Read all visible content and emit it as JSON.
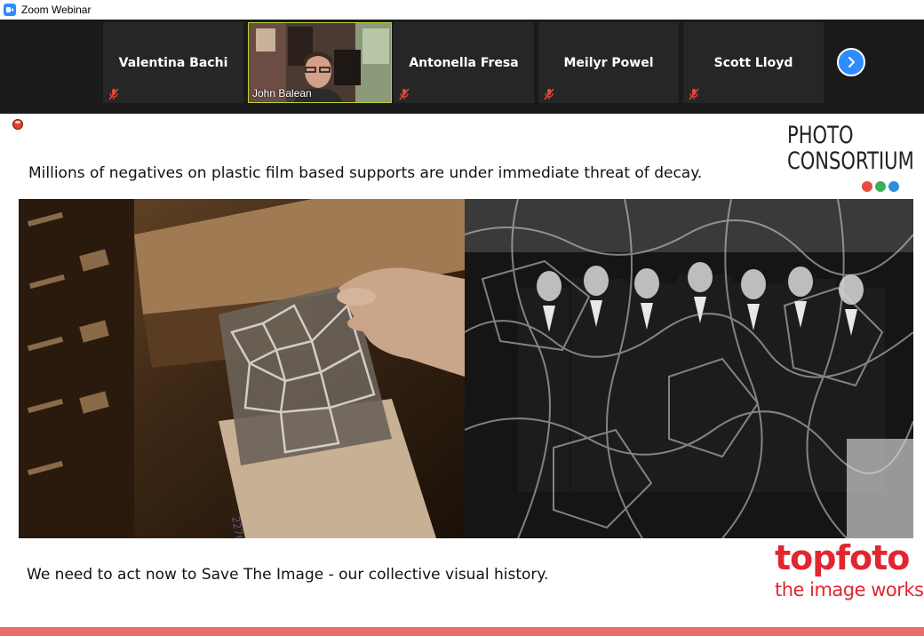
{
  "window": {
    "title": "Zoom Webinar"
  },
  "participants": [
    {
      "name": "Valentina Bachi",
      "muted": true
    },
    {
      "name": "John Balean",
      "video": true
    },
    {
      "name": "Antonella Fresa",
      "muted": true
    },
    {
      "name": "Meilyr Powel",
      "muted": true
    },
    {
      "name": "Scott Lloyd",
      "muted": true
    }
  ],
  "slide": {
    "top_text": "Millions of negatives on plastic film based supports are under immediate threat of decay.",
    "bottom_text": "We need to act now to Save The Image - our collective visual history.",
    "logo": {
      "line1": "PHOTO",
      "line2": "CONSORTIUM",
      "dot_colors": [
        "#e94b3c",
        "#3cae5a",
        "#2d8ed8"
      ]
    },
    "brand": {
      "name": "topfoto",
      "tagline": "the image works",
      "color": "#e2262f"
    },
    "film_number": "227629"
  },
  "icons": {
    "mic": "mic-muted-icon",
    "next": "chevron-right-icon",
    "record": "recording-icon"
  },
  "colors": {
    "accent": "#2d8cff",
    "strip_bg": "#1a1a1a",
    "tile_bg": "#262626",
    "active_border": "#b5d43a",
    "bottom_bar": "#ec6a6a"
  }
}
